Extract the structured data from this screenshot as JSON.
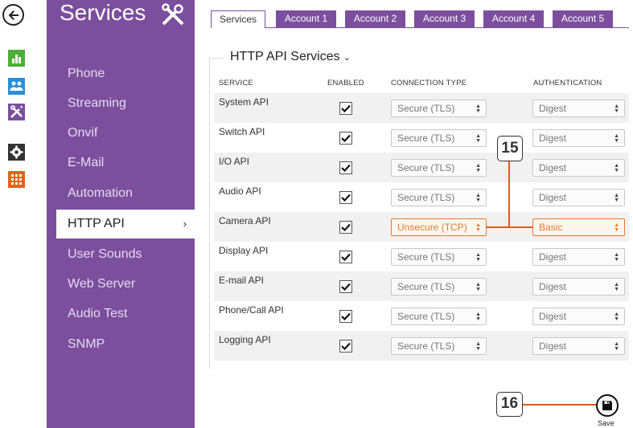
{
  "sidebar": {
    "title": "Services",
    "items": [
      {
        "label": "Phone"
      },
      {
        "label": "Streaming"
      },
      {
        "label": "Onvif"
      },
      {
        "label": "E-Mail"
      },
      {
        "label": "Automation"
      },
      {
        "label": "HTTP API",
        "active": true,
        "chevron": "›"
      },
      {
        "label": "User Sounds"
      },
      {
        "label": "Web Server"
      },
      {
        "label": "Audio Test"
      },
      {
        "label": "SNMP"
      }
    ]
  },
  "rail_icons": [
    {
      "name": "status-icon",
      "color": "#4caf3a"
    },
    {
      "name": "directory-icon",
      "color": "#2a8fd8"
    },
    {
      "name": "services-icon",
      "color": "#7b4f9d"
    },
    {
      "name": "hardware-icon",
      "color": "#333333"
    },
    {
      "name": "system-icon",
      "color": "#e8611a"
    }
  ],
  "tabs": [
    "Services",
    "Account 1",
    "Account 2",
    "Account 3",
    "Account 4",
    "Account 5"
  ],
  "section": {
    "title": "HTTP API Services",
    "caret": "⌄"
  },
  "columns": {
    "service": "SERVICE",
    "enabled": "ENABLED",
    "connection": "CONNECTION TYPE",
    "authentication": "AUTHENTICATION"
  },
  "rows": [
    {
      "service": "System API",
      "enabled": true,
      "connection": "Secure (TLS)",
      "auth": "Digest"
    },
    {
      "service": "Switch API",
      "enabled": true,
      "connection": "Secure (TLS)",
      "auth": "Digest"
    },
    {
      "service": "I/O API",
      "enabled": true,
      "connection": "Secure (TLS)",
      "auth": "Digest"
    },
    {
      "service": "Audio API",
      "enabled": true,
      "connection": "Secure (TLS)",
      "auth": "Digest"
    },
    {
      "service": "Camera API",
      "enabled": true,
      "connection": "Unsecure (TCP)",
      "auth": "Basic",
      "highlight": true
    },
    {
      "service": "Display API",
      "enabled": true,
      "connection": "Secure (TLS)",
      "auth": "Digest"
    },
    {
      "service": "E-mail API",
      "enabled": true,
      "connection": "Secure (TLS)",
      "auth": "Digest"
    },
    {
      "service": "Phone/Call API",
      "enabled": true,
      "connection": "Secure (TLS)",
      "auth": "Digest"
    },
    {
      "service": "Logging API",
      "enabled": true,
      "connection": "Secure (TLS)",
      "auth": "Digest"
    }
  ],
  "callouts": {
    "select_callout": "15",
    "save_callout": "16"
  },
  "save": {
    "label": "Save"
  },
  "colors": {
    "purple": "#7b4f9d",
    "highlight": "#e87a2a",
    "callout_line": "#e05a1c"
  }
}
